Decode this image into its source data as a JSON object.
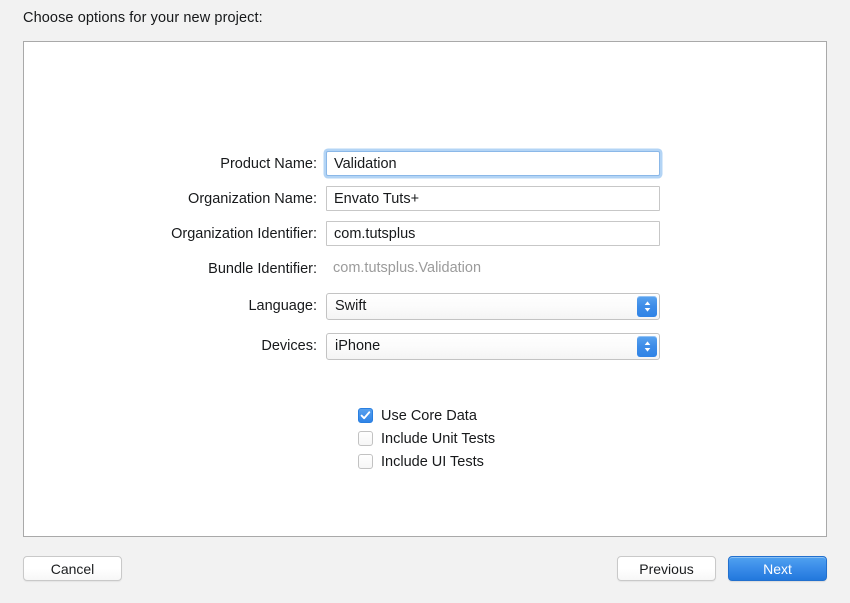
{
  "heading": "Choose options for your new project:",
  "form": {
    "rows": [
      {
        "label": "Product Name:",
        "value": "Validation",
        "type": "text",
        "focused": true
      },
      {
        "label": "Organization Name:",
        "value": "Envato Tuts+",
        "type": "text",
        "focused": false
      },
      {
        "label": "Organization Identifier:",
        "value": "com.tutsplus",
        "type": "text",
        "focused": false
      },
      {
        "label": "Bundle Identifier:",
        "value": "com.tutsplus.Validation",
        "type": "static",
        "focused": false
      },
      {
        "label": "Language:",
        "value": "Swift",
        "type": "popup",
        "focused": false
      },
      {
        "label": "Devices:",
        "value": "iPhone",
        "type": "popup",
        "focused": false
      }
    ]
  },
  "checkboxes": [
    {
      "label": "Use Core Data",
      "checked": true
    },
    {
      "label": "Include Unit Tests",
      "checked": false
    },
    {
      "label": "Include UI Tests",
      "checked": false
    }
  ],
  "buttons": {
    "cancel": "Cancel",
    "previous": "Previous",
    "next": "Next"
  },
  "colors": {
    "accent": "#2f84e7",
    "focus_ring": "#b3d4f5",
    "page_background": "#f2f2f2",
    "panel_background": "#ffffff",
    "panel_border": "#a9a9a9",
    "static_text": "#9b9b9b",
    "text": "#17191b"
  }
}
